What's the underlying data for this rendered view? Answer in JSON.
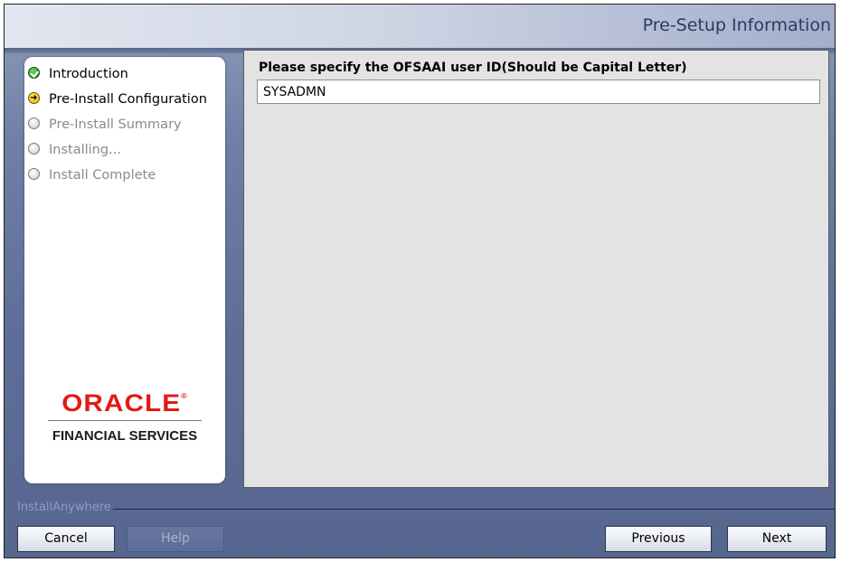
{
  "window": {
    "title": "Pre-Setup Information"
  },
  "steps": [
    {
      "label": "Introduction",
      "state": "done"
    },
    {
      "label": "Pre-Install Configuration",
      "state": "current"
    },
    {
      "label": "Pre-Install Summary",
      "state": "pending"
    },
    {
      "label": "Installing...",
      "state": "pending"
    },
    {
      "label": "Install Complete",
      "state": "pending"
    }
  ],
  "logo": {
    "brand": "ORACLE",
    "tagline": "FINANCIAL SERVICES"
  },
  "form": {
    "prompt": "Please specify the OFSAAI user ID(Should be Capital Letter)",
    "user_id_value": "SYSADMN"
  },
  "footer": {
    "brand": "InstallAnywhere",
    "cancel_label": "Cancel",
    "help_label": "Help",
    "previous_label": "Previous",
    "next_label": "Next"
  },
  "colors": {
    "accent": "#2a3a66",
    "oracle_red": "#e21b13",
    "panel_bg": "#e3e3e3"
  }
}
